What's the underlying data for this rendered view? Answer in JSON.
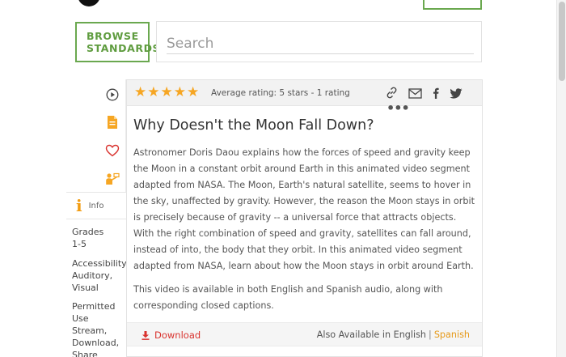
{
  "header": {
    "browse_label": "BROWSE STANDARDS"
  },
  "search": {
    "placeholder": "Search",
    "value": ""
  },
  "rating": {
    "stars": 5,
    "text": "Average rating: 5 stars - 1 rating"
  },
  "resource": {
    "title": "Why Doesn't the Moon Fall Down?",
    "description": "Astronomer Doris Daou explains how the forces of speed and gravity keep the Moon in a constant orbit around Earth in this animated video segment adapted from NASA. The Moon, Earth's natural satellite, seems to hover in the sky, unaffected by gravity. However, the reason the Moon stays in orbit is precisely because of gravity -- a universal force that attracts objects. With the right combination of speed and gravity, satellites can fall around, instead of into, the body that they orbit. In this animated video segment adapted from NASA, learn about how the Moon stays in orbit around Earth.",
    "availability": "This video is available in both English and Spanish audio, along with corresponding closed captions."
  },
  "info": {
    "tab_label": "Info",
    "grades_label": "Grades",
    "grades_value": "1-5",
    "accessibility_label": "Accessibility",
    "accessibility_value": "Auditory, Visual",
    "permitted_label": "Permitted Use",
    "permitted_value": "Stream, Download, Share"
  },
  "footer": {
    "download_label": "Download",
    "also_label": "Also Available in English",
    "separator": "|",
    "spanish_label": "Spanish"
  },
  "colors": {
    "accent_green": "#6aa84f",
    "star": "#f6a623",
    "download_red": "#d9322e",
    "spanish_orange": "#e69a1a",
    "info_orange": "#f29c11"
  },
  "icons": [
    "play-icon",
    "document-icon",
    "heart-icon",
    "teacher-icon",
    "link-icon",
    "mail-icon",
    "facebook-icon",
    "twitter-icon",
    "more-icon",
    "download-icon",
    "info-icon"
  ]
}
